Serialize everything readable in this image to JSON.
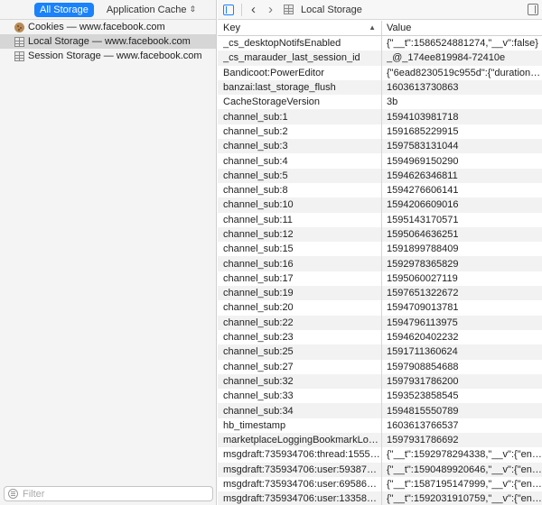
{
  "sidebar": {
    "all_storage_label": "All Storage",
    "application_cache_label": "Application Cache",
    "items": [
      {
        "label": "Cookies — www.facebook.com",
        "icon": "cookie-icon",
        "selected": false
      },
      {
        "label": "Local Storage — www.facebook.com",
        "icon": "local-storage-icon",
        "selected": true
      },
      {
        "label": "Session Storage — www.facebook.com",
        "icon": "session-storage-icon",
        "selected": false
      }
    ],
    "filter_placeholder": "Filter"
  },
  "toolbar": {
    "title": "Local Storage"
  },
  "table": {
    "columns": [
      "Key",
      "Value"
    ],
    "rows": [
      [
        "_cs_desktopNotifsEnabled",
        "{\"__t\":1586524881274,\"__v\":false}"
      ],
      [
        "_cs_marauder_last_session_id",
        "_@_174ee819984-72410e"
      ],
      [
        "Bandicoot:PowerEditor",
        "{\"6ead8230519c955d\":{\"duration\":7..."
      ],
      [
        "banzai:last_storage_flush",
        "1603613730863"
      ],
      [
        "CacheStorageVersion",
        "3b"
      ],
      [
        "channel_sub:1",
        "1594103981718"
      ],
      [
        "channel_sub:2",
        "1591685229915"
      ],
      [
        "channel_sub:3",
        "1597583131044"
      ],
      [
        "channel_sub:4",
        "1594969150290"
      ],
      [
        "channel_sub:5",
        "1594626346811"
      ],
      [
        "channel_sub:8",
        "1594276606141"
      ],
      [
        "channel_sub:10",
        "1594206609016"
      ],
      [
        "channel_sub:11",
        "1595143170571"
      ],
      [
        "channel_sub:12",
        "1595064636251"
      ],
      [
        "channel_sub:15",
        "1591899788409"
      ],
      [
        "channel_sub:16",
        "1592978365829"
      ],
      [
        "channel_sub:17",
        "1595060027119"
      ],
      [
        "channel_sub:19",
        "1597651322672"
      ],
      [
        "channel_sub:20",
        "1594709013781"
      ],
      [
        "channel_sub:22",
        "1594796113975"
      ],
      [
        "channel_sub:23",
        "1594620402232"
      ],
      [
        "channel_sub:25",
        "1591711360624"
      ],
      [
        "channel_sub:27",
        "1597908854688"
      ],
      [
        "channel_sub:32",
        "1597931786200"
      ],
      [
        "channel_sub:33",
        "1593523858545"
      ],
      [
        "channel_sub:34",
        "1594815550789"
      ],
      [
        "hb_timestamp",
        "1603613766537"
      ],
      [
        "marketplaceLoggingBookmarkLogTim...",
        "1597931786692"
      ],
      [
        "msgdraft:735934706:thread:155503...",
        "{\"__t\":1592978294338,\"__v\":{\"encod..."
      ],
      [
        "msgdraft:735934706:user:593878116",
        "{\"__t\":1590489920646,\"__v\":{\"encod..."
      ],
      [
        "msgdraft:735934706:user:695860884",
        "{\"__t\":1587195147999,\"__v\":{\"encod..."
      ],
      [
        "msgdraft:735934706:user:13358781...",
        "{\"__t\":1592031910759,\"__v\":{\"encod..."
      ]
    ]
  }
}
